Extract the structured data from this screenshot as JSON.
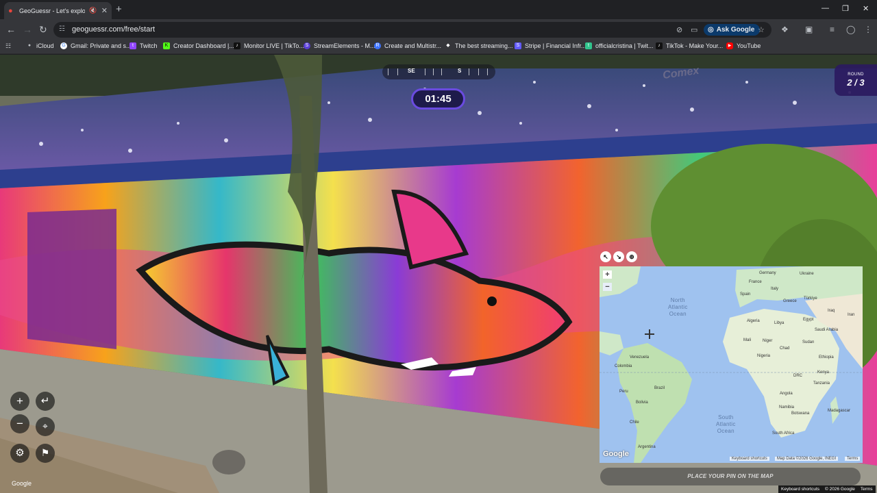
{
  "browser": {
    "tab_title": "GeoGuessr - Let's explore th",
    "tab_close": "✕",
    "new_tab": "+",
    "url": "geoguessr.com/free/start",
    "ask_google": "Ask Google",
    "window_controls": [
      "—",
      "❐",
      "✕"
    ]
  },
  "bookmarks": [
    {
      "label": "iCloud",
      "icon": "apple-icon",
      "color": "#9aa0a6"
    },
    {
      "label": "Gmail: Private and s...",
      "icon": "google-icon",
      "color": "#ffffff"
    },
    {
      "label": "Twitch",
      "icon": "twitch-icon",
      "color": "#9146ff"
    },
    {
      "label": "Creator Dashboard |...",
      "icon": "kick-icon",
      "color": "#53fc18"
    },
    {
      "label": "Monitor LIVE | TikTo...",
      "icon": "tiktok-icon",
      "color": "#111111"
    },
    {
      "label": "StreamElements - M...",
      "icon": "streamelements-icon",
      "color": "#5a3fd6"
    },
    {
      "label": "Create and Multistr...",
      "icon": "restream-icon",
      "color": "#3d73ff"
    },
    {
      "label": "The best streaming...",
      "icon": "diamond-icon",
      "color": "#ffffff"
    },
    {
      "label": "Stripe | Financial Infr...",
      "icon": "stripe-icon",
      "color": "#635bff"
    },
    {
      "label": "officialcristina | Twit...",
      "icon": "twitch-green-icon",
      "color": "#31c48d"
    },
    {
      "label": "TikTok - Make Your...",
      "icon": "tiktok-icon",
      "color": "#111111"
    },
    {
      "label": "YouTube",
      "icon": "youtube-icon",
      "color": "#ff0000"
    }
  ],
  "game": {
    "compass": {
      "se": "SE",
      "s": "S"
    },
    "timer": "01:45",
    "round_label": "ROUND",
    "round_value": "2 / 3",
    "place_pin": "PLACE YOUR PIN ON THE MAP",
    "google": "Google",
    "footer": {
      "shortcuts": "Keyboard shortcuts",
      "data": "© 2026 Google",
      "terms": "Terms"
    }
  },
  "map": {
    "zoom_in": "+",
    "zoom_out": "−",
    "oceans": [
      {
        "text": "North\nAtlantic\nOcean"
      },
      {
        "text": "South\nAtlantic\nOcean"
      }
    ],
    "countries": [
      "Germany",
      "Ukraine",
      "France",
      "Italy",
      "Spain",
      "Türkiye",
      "Greece",
      "Algeria",
      "Libya",
      "Egypt",
      "Iraq",
      "Iran",
      "Saudi Arabia",
      "Mali",
      "Niger",
      "Chad",
      "Sudan",
      "Nigeria",
      "Ethiopia",
      "DRC",
      "Kenya",
      "Tanzania",
      "Angola",
      "Namibia",
      "Botswana",
      "Madagascar",
      "South Africa",
      "Venezuela",
      "Colombia",
      "Peru",
      "Brazil",
      "Bolivia",
      "Chile",
      "Argentina"
    ],
    "google": "Google",
    "footer": {
      "shortcuts": "Keyboard shortcuts",
      "data": "Map Data ©2026 Google, INEGI",
      "terms": "Terms"
    }
  }
}
